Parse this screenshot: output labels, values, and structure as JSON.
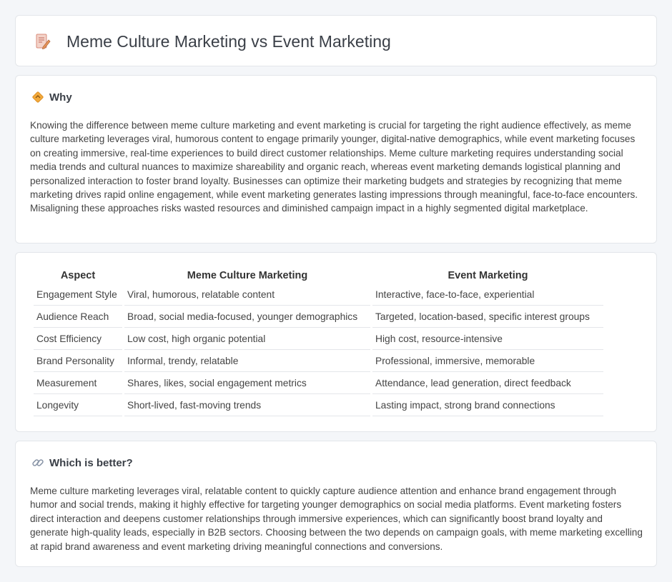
{
  "header": {
    "title": "Meme Culture Marketing vs Event Marketing",
    "icon": "document-pen-icon"
  },
  "why": {
    "title": "Why",
    "icon": "diamond-sign-icon",
    "text": "Knowing the difference between meme culture marketing and event marketing is crucial for targeting the right audience effectively, as meme culture marketing leverages viral, humorous content to engage primarily younger, digital-native demographics, while event marketing focuses on creating immersive, real-time experiences to build direct customer relationships. Meme culture marketing requires understanding social media trends and cultural nuances to maximize shareability and organic reach, whereas event marketing demands logistical planning and personalized interaction to foster brand loyalty. Businesses can optimize their marketing budgets and strategies by recognizing that meme marketing drives rapid online engagement, while event marketing generates lasting impressions through meaningful, face-to-face encounters. Misaligning these approaches risks wasted resources and diminished campaign impact in a highly segmented digital marketplace."
  },
  "table": {
    "headers": [
      "Aspect",
      "Meme Culture Marketing",
      "Event Marketing"
    ],
    "rows": [
      [
        "Engagement Style",
        "Viral, humorous, relatable content",
        "Interactive, face-to-face, experiential"
      ],
      [
        "Audience Reach",
        "Broad, social media-focused, younger demographics",
        "Targeted, location-based, specific interest groups"
      ],
      [
        "Cost Efficiency",
        "Low cost, high organic potential",
        "High cost, resource-intensive"
      ],
      [
        "Brand Personality",
        "Informal, trendy, relatable",
        "Professional, immersive, memorable"
      ],
      [
        "Measurement",
        "Shares, likes, social engagement metrics",
        "Attendance, lead generation, direct feedback"
      ],
      [
        "Longevity",
        "Short-lived, fast-moving trends",
        "Lasting impact, strong brand connections"
      ]
    ]
  },
  "better": {
    "title": "Which is better?",
    "icon": "link-icon",
    "text": "Meme culture marketing leverages viral, relatable content to quickly capture audience attention and enhance brand engagement through humor and social trends, making it highly effective for targeting younger demographics on social media platforms. Event marketing fosters direct interaction and deepens customer relationships through immersive experiences, which can significantly boost brand loyalty and generate high-quality leads, especially in B2B sectors. Choosing between the two depends on campaign goals, with meme marketing excelling at rapid brand awareness and event marketing driving meaningful connections and conversions."
  }
}
